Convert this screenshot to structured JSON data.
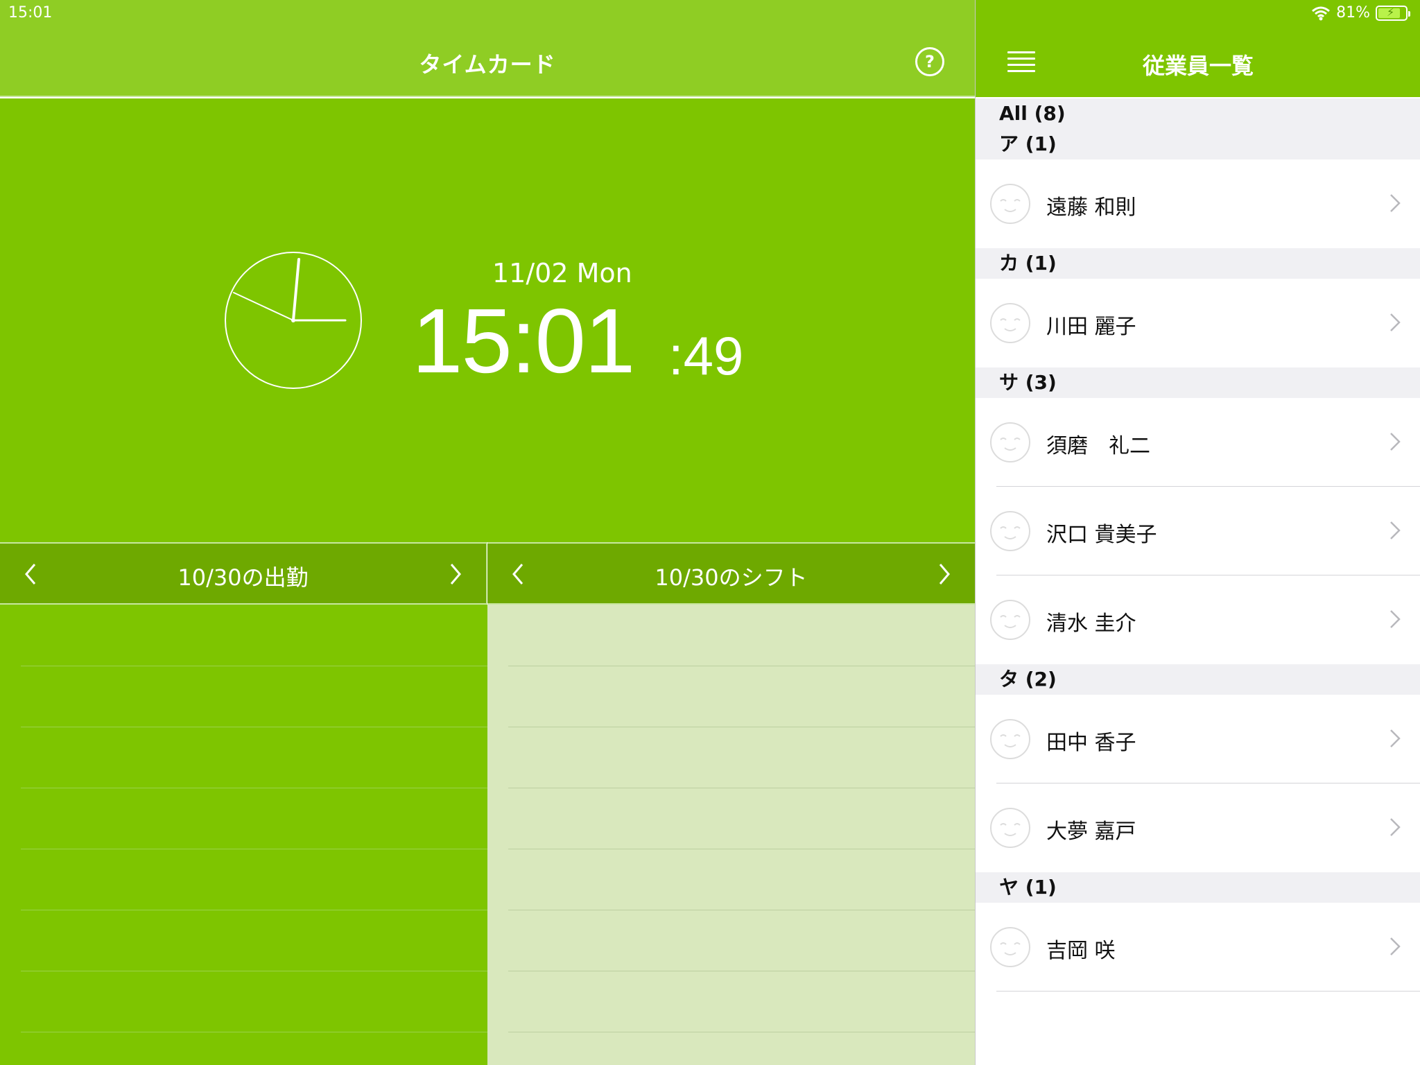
{
  "status": {
    "time": "15:01",
    "battery": "81%"
  },
  "timecard": {
    "title": "タイムカード",
    "help": "?",
    "date": "11/02 Mon",
    "time_hm": "15:01",
    "time_sec": ":49",
    "attendance_title": "10/30の出勤",
    "shift_title": "10/30のシフト"
  },
  "employees": {
    "title": "従業員一覧",
    "all_label": "All (8)",
    "groups": [
      {
        "label": "ア (1)",
        "members": [
          "遠藤 和則"
        ]
      },
      {
        "label": "カ (1)",
        "members": [
          "川田 麗子"
        ]
      },
      {
        "label": "サ (3)",
        "members": [
          "須磨　礼二",
          "沢口 貴美子",
          "清水 圭介"
        ]
      },
      {
        "label": "タ (2)",
        "members": [
          "田中 香子",
          "大夢 嘉戸"
        ]
      },
      {
        "label": "ヤ (1)",
        "members": [
          "吉岡 咲"
        ]
      }
    ]
  },
  "colors": {
    "header_green": "#8fcd24",
    "main_green": "#7ec500",
    "dark_green": "#6ea900",
    "shift_bg": "#d9e8bd"
  }
}
